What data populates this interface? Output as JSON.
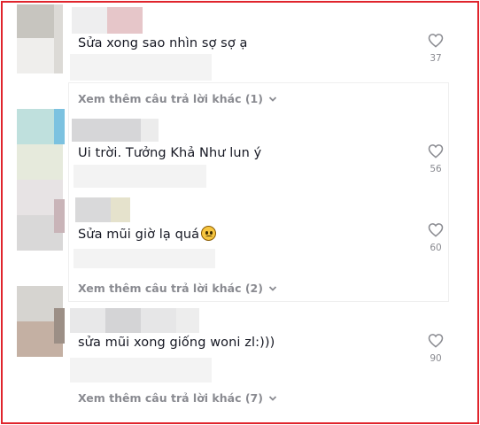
{
  "comments": [
    {
      "text": "Sửa xong sao nhìn sợ sợ ạ",
      "likes": "37",
      "more_replies": "Xem thêm câu trả lời khác (1)"
    },
    {
      "text": "Ui trời. Tưởng Khả Như lun ý",
      "likes": "56",
      "more_replies": ""
    },
    {
      "text": "Sửa mũi giờ lạ quá",
      "likes": "60",
      "more_replies": "Xem thêm câu trả lời khác (2)"
    },
    {
      "text": "sửa mũi xong giống woni zl:)))",
      "likes": "90",
      "more_replies": "Xem thêm câu trả lời khác (7)"
    }
  ],
  "icons": {
    "like": "heart-outline-icon",
    "expand": "chevron-down-icon",
    "emoji": "confused-face-emoji-icon"
  },
  "colors": {
    "frame_border": "#e0242c",
    "text": "#161823",
    "muted": "#8a8b91"
  }
}
